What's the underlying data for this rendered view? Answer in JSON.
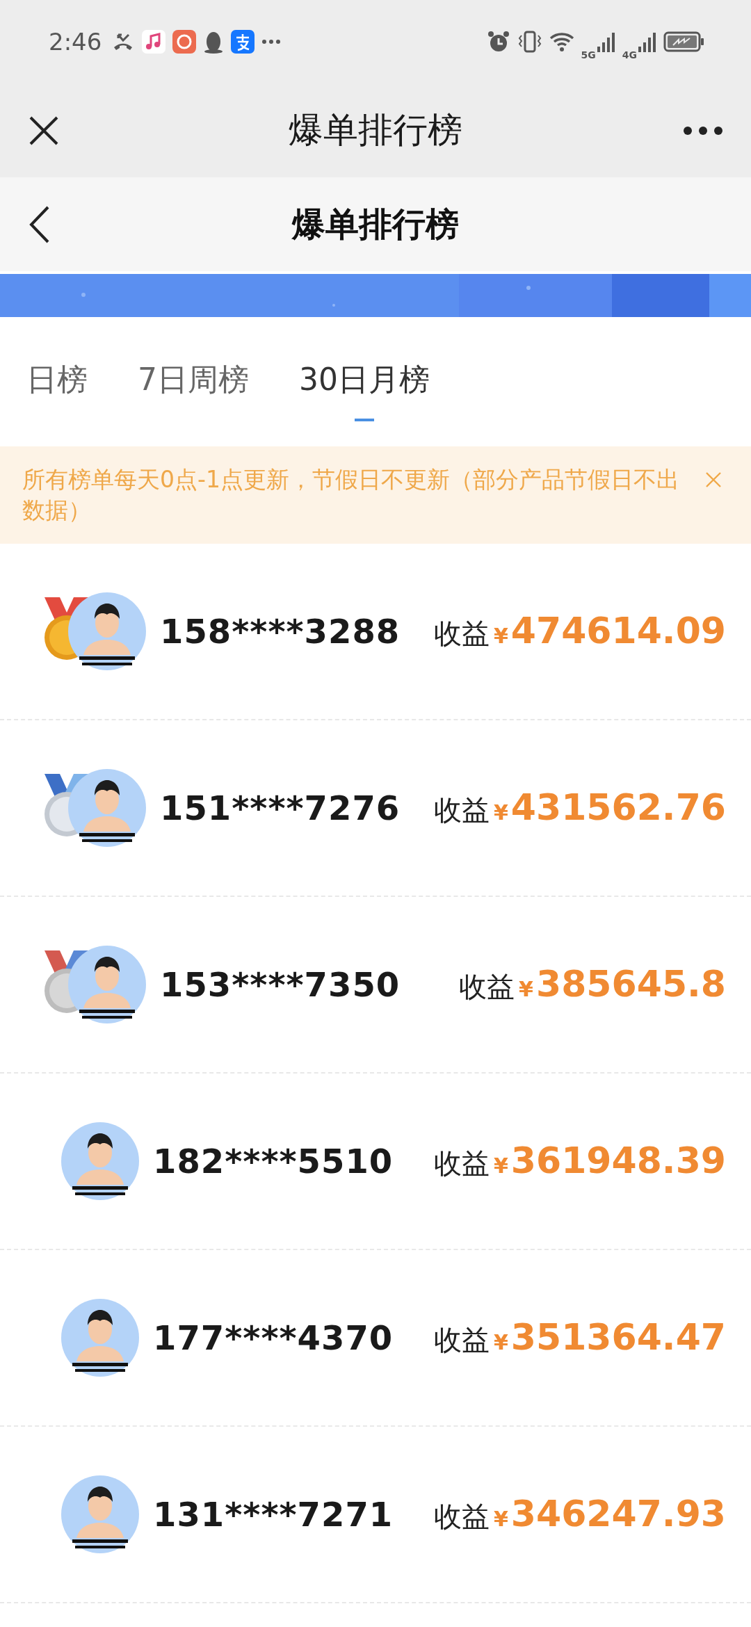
{
  "status_bar": {
    "time": "2:46",
    "network_1": "5G",
    "network_2": "4G"
  },
  "title_bar": {
    "title": "爆单排行榜"
  },
  "header": {
    "title": "爆单排行榜"
  },
  "tabs": [
    {
      "label": "日榜",
      "selected": false
    },
    {
      "label": "7日周榜",
      "selected": false
    },
    {
      "label": "30日月榜",
      "selected": true
    }
  ],
  "notice": {
    "text": "所有榜单每天0点-1点更新，节假日不更新（部分产品节假日不出数据）"
  },
  "rows": [
    {
      "kind": "gold",
      "phone": "158****3288",
      "label": "收益",
      "currency": "¥",
      "amount": "474614.09"
    },
    {
      "kind": "silver",
      "phone": "151****7276",
      "label": "收益",
      "currency": "¥",
      "amount": "431562.76"
    },
    {
      "kind": "bronze",
      "phone": "153****7350",
      "label": "收益",
      "currency": "¥",
      "amount": "385645.8"
    },
    {
      "kind": "plain",
      "phone": "182****5510",
      "label": "收益",
      "currency": "¥",
      "amount": "361948.39"
    },
    {
      "kind": "plain",
      "phone": "177****4370",
      "label": "收益",
      "currency": "¥",
      "amount": "351364.47"
    },
    {
      "kind": "plain",
      "phone": "131****7271",
      "label": "收益",
      "currency": "¥",
      "amount": "346247.93"
    }
  ]
}
